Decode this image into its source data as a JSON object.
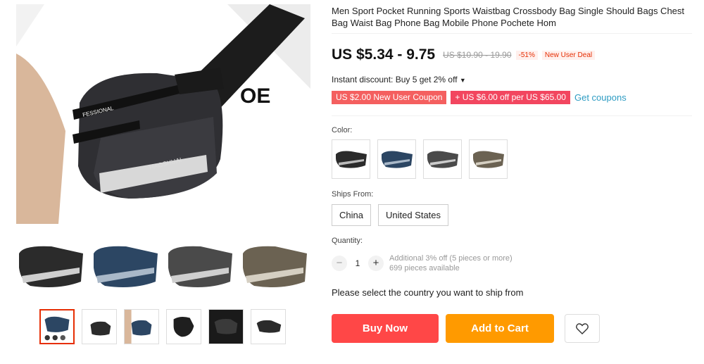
{
  "gallery": {
    "main_image_icon": "product-photo-waist-bag",
    "main_image_text": "FESSIONAL",
    "main_image_brand": "HAOSHUAI",
    "variant_strip_icons": [
      "black-bag",
      "blue-bag",
      "grey-bag",
      "khaki-bag"
    ],
    "thumbnails": [
      "thumb-1",
      "thumb-2",
      "thumb-3",
      "thumb-4",
      "thumb-5",
      "thumb-6"
    ]
  },
  "product": {
    "title": "Men Sport Pocket Running Sports Waistbag Crossbody Bag Single Should Bags Chest Bag Waist Bag Phone Bag Mobile Phone Pochete Hom",
    "price": "US $5.34 - 9.75",
    "original_price": "US $10.90 - 19.90",
    "discount": "-51%",
    "new_user_deal": "New User Deal",
    "instant_discount": "Instant discount: Buy 5 get 2% off",
    "coupon_1": "US $2.00 New User Coupon",
    "coupon_2": "US $6.00 off per US $65.00",
    "get_coupons": "Get coupons"
  },
  "color": {
    "label": "Color:",
    "options": [
      {
        "name": "black",
        "color": "#2b2b2b"
      },
      {
        "name": "blue",
        "color": "#2c4663"
      },
      {
        "name": "grey",
        "color": "#4a4a4a"
      },
      {
        "name": "khaki",
        "color": "#6b6252"
      }
    ]
  },
  "shipping": {
    "label": "Ships From:",
    "options": [
      "China",
      "United States"
    ],
    "message": "Please select the country you want to ship from"
  },
  "quantity": {
    "label": "Quantity:",
    "minus": "−",
    "plus": "+",
    "value": "1",
    "additional": "Additional 3% off (5 pieces or more)",
    "available": "699 pieces available"
  },
  "actions": {
    "buy_now": "Buy Now",
    "add_to_cart": "Add to Cart",
    "wishlist_icon": "heart-icon"
  },
  "colors": {
    "price": "#111111",
    "accent_red": "#ff4747",
    "accent_orange": "#ff9a00",
    "coupon_red": "#f45f5f",
    "coupon_pink": "#f2465f",
    "link_blue": "#2e9cc3"
  }
}
